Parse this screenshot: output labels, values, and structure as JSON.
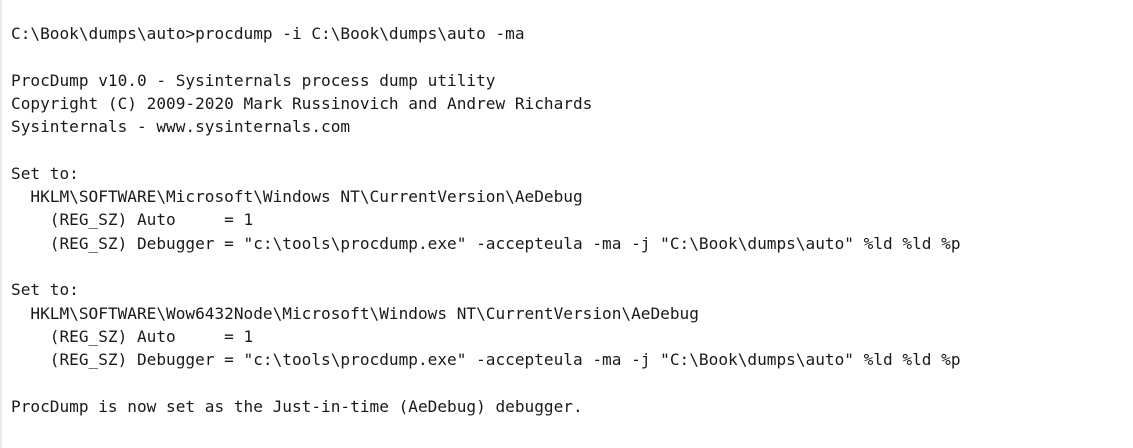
{
  "terminal": {
    "lines": [
      "C:\\Book\\dumps\\auto>procdump -i C:\\Book\\dumps\\auto -ma",
      "",
      "ProcDump v10.0 - Sysinternals process dump utility",
      "Copyright (C) 2009-2020 Mark Russinovich and Andrew Richards",
      "Sysinternals - www.sysinternals.com",
      "",
      "Set to:",
      "  HKLM\\SOFTWARE\\Microsoft\\Windows NT\\CurrentVersion\\AeDebug",
      "    (REG_SZ) Auto     = 1",
      "    (REG_SZ) Debugger = \"c:\\tools\\procdump.exe\" -accepteula -ma -j \"C:\\Book\\dumps\\auto\" %ld %ld %p",
      "",
      "Set to:",
      "  HKLM\\SOFTWARE\\Wow6432Node\\Microsoft\\Windows NT\\CurrentVersion\\AeDebug",
      "    (REG_SZ) Auto     = 1",
      "    (REG_SZ) Debugger = \"c:\\tools\\procdump.exe\" -accepteula -ma -j \"C:\\Book\\dumps\\auto\" %ld %ld %p",
      "",
      "ProcDump is now set as the Just-in-time (AeDebug) debugger."
    ]
  }
}
